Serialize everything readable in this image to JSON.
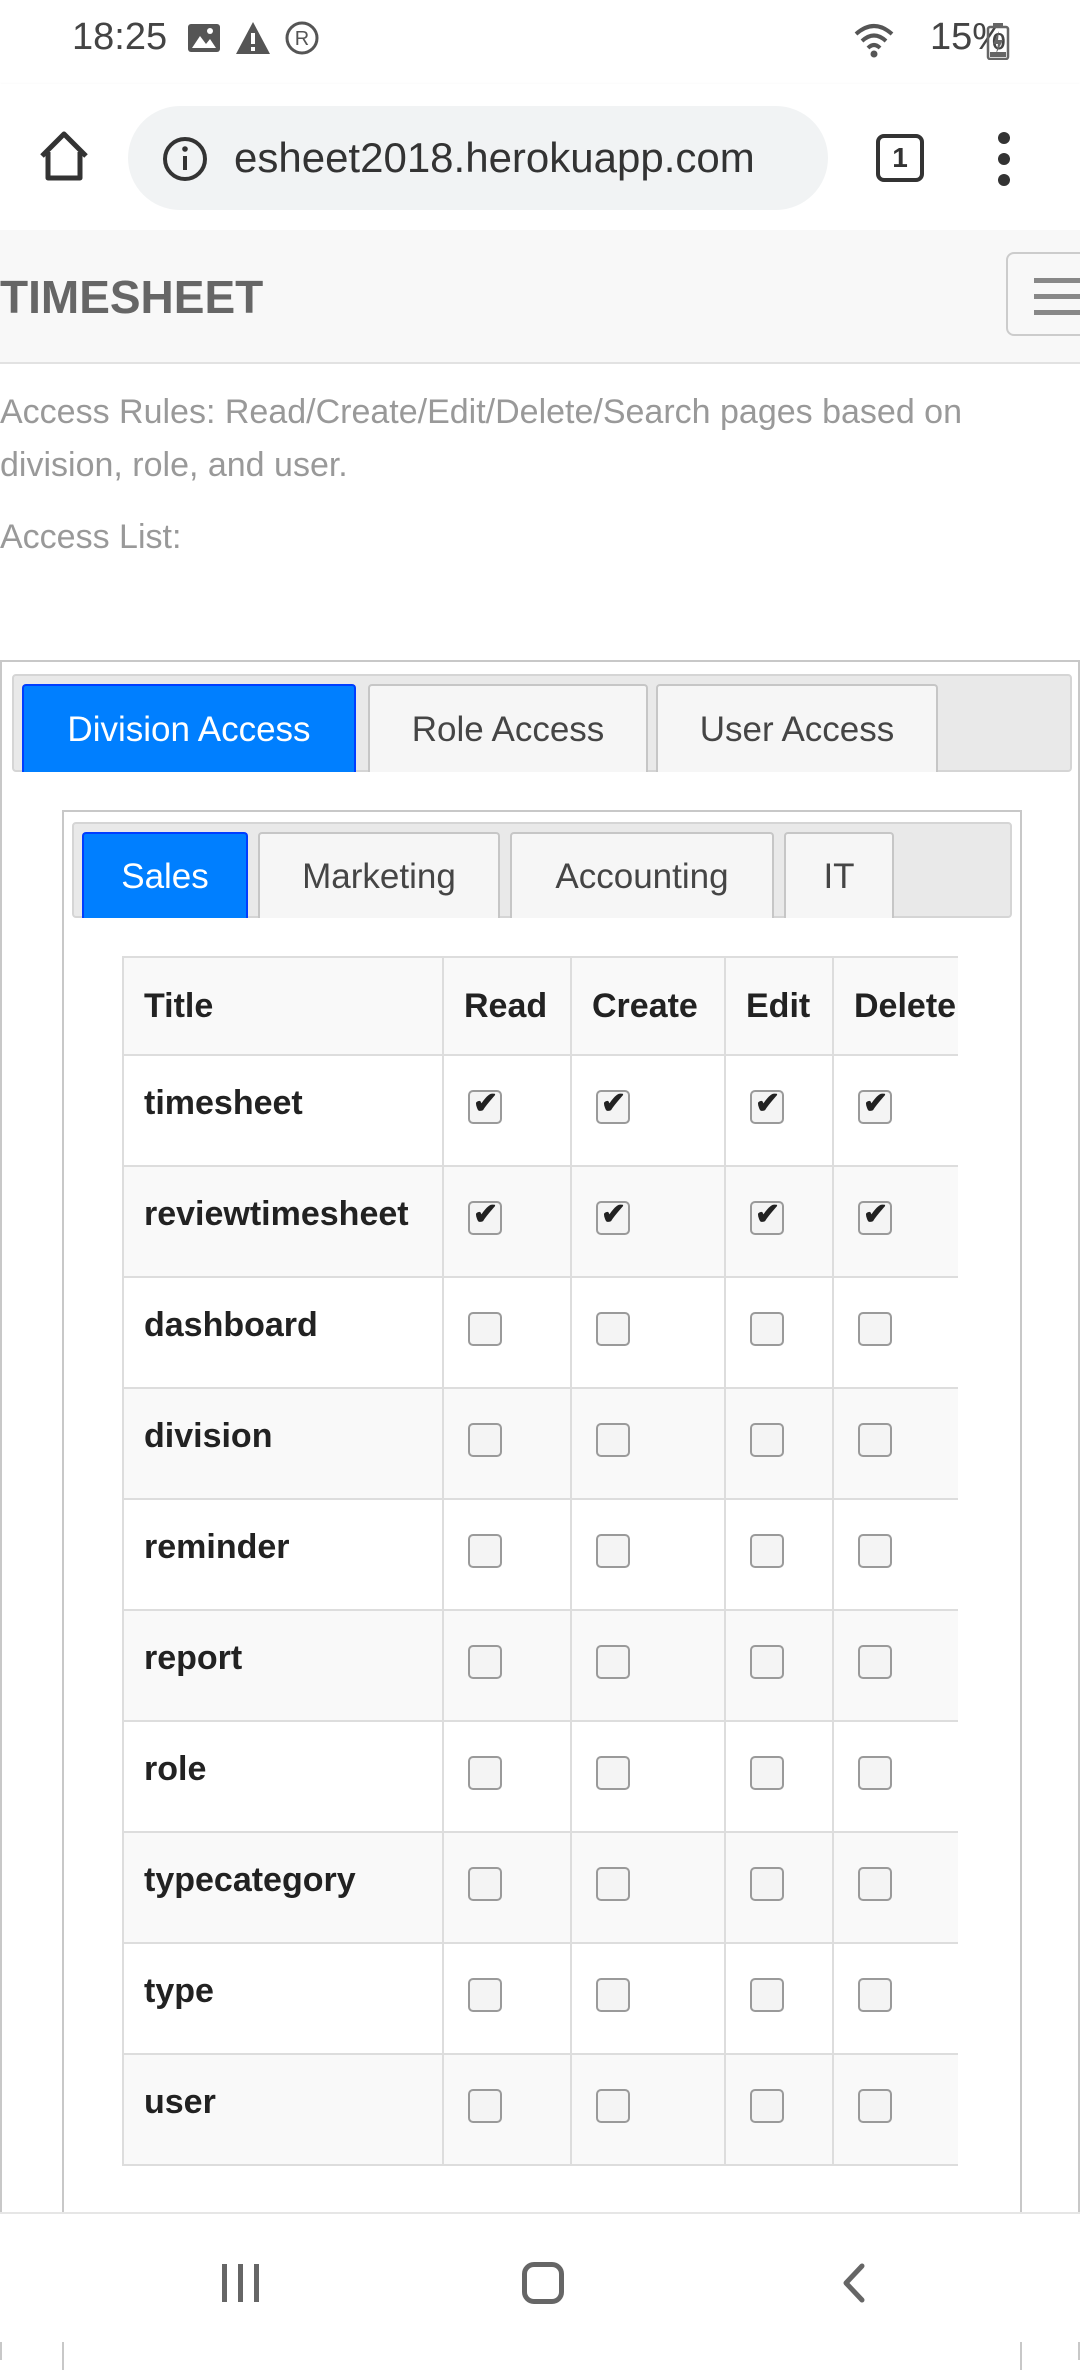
{
  "status": {
    "time": "18:25",
    "battery": "15%"
  },
  "browser": {
    "url": "esheet2018.herokuapp.com",
    "tab_count": "1"
  },
  "navbar": {
    "brand": "TIMESHEET"
  },
  "content": {
    "rules": "Access Rules: Read/Create/Edit/Delete/Search pages based on division, role, and user.",
    "access_list": "Access List:"
  },
  "tabs": [
    "Division Access",
    "Role Access",
    "User Access"
  ],
  "subtabs": [
    "Sales",
    "Marketing",
    "Accounting",
    "IT"
  ],
  "table": {
    "headers": [
      "Title",
      "Read",
      "Create",
      "Edit",
      "Delete"
    ],
    "rows": [
      {
        "title": "timesheet",
        "read": true,
        "create": true,
        "edit": true,
        "delete": true
      },
      {
        "title": "reviewtimesheet",
        "read": true,
        "create": true,
        "edit": true,
        "delete": true
      },
      {
        "title": "dashboard",
        "read": false,
        "create": false,
        "edit": false,
        "delete": false
      },
      {
        "title": "division",
        "read": false,
        "create": false,
        "edit": false,
        "delete": false
      },
      {
        "title": "reminder",
        "read": false,
        "create": false,
        "edit": false,
        "delete": false
      },
      {
        "title": "report",
        "read": false,
        "create": false,
        "edit": false,
        "delete": false
      },
      {
        "title": "role",
        "read": false,
        "create": false,
        "edit": false,
        "delete": false
      },
      {
        "title": "typecategory",
        "read": false,
        "create": false,
        "edit": false,
        "delete": false
      },
      {
        "title": "type",
        "read": false,
        "create": false,
        "edit": false,
        "delete": false
      },
      {
        "title": "user",
        "read": false,
        "create": false,
        "edit": false,
        "delete": false
      }
    ]
  },
  "colors": {
    "accent": "#007fff",
    "accent_border": "#003eff"
  }
}
